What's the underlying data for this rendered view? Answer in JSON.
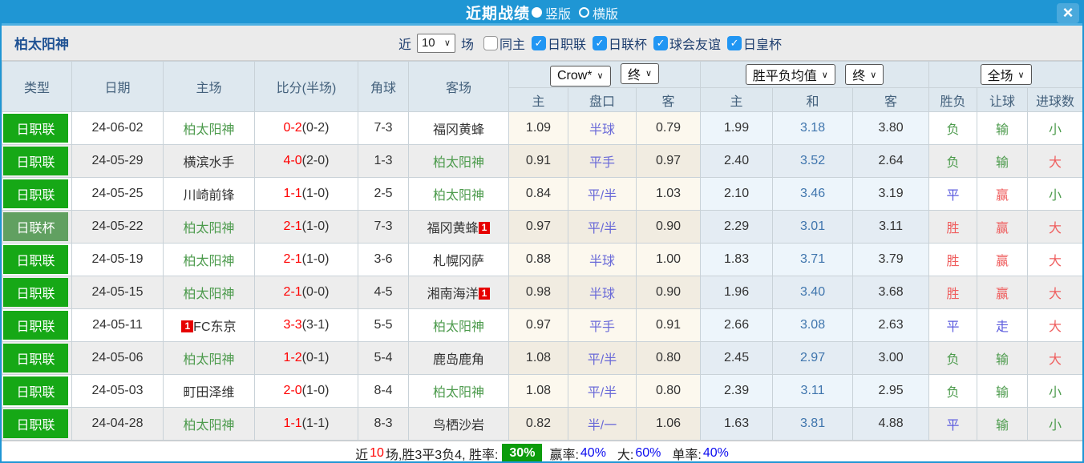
{
  "window": {
    "title": "近期战绩",
    "close_glyph": "×"
  },
  "layout_toggle": {
    "options": [
      {
        "label": "竖版",
        "selected": true
      },
      {
        "label": "横版",
        "selected": false
      }
    ]
  },
  "filter_bar": {
    "team_name": "柏太阳神",
    "recent_label": "近",
    "recent_count": "10",
    "games_label": "场",
    "checkboxes": [
      {
        "label": "同主",
        "checked": false
      },
      {
        "label": "日职联",
        "checked": true
      },
      {
        "label": "日联杯",
        "checked": true
      },
      {
        "label": "球会友谊",
        "checked": true
      },
      {
        "label": "日皇杯",
        "checked": true
      }
    ]
  },
  "table": {
    "dropdowns": {
      "odds_company": "Crow*",
      "odds_time1": "终",
      "avg_label": "胜平负均值",
      "odds_time2": "终",
      "period": "全场"
    },
    "columns": {
      "type": "类型",
      "date": "日期",
      "home": "主场",
      "score": "比分(半场)",
      "corner": "角球",
      "away": "客场",
      "sub": [
        "主",
        "盘口",
        "客",
        "主",
        "和",
        "客",
        "胜负",
        "让球",
        "进球数"
      ]
    },
    "rows": [
      {
        "league": "日职联",
        "league_type": "league",
        "date": "24-06-02",
        "home": "柏太阳神",
        "home_team": true,
        "home_red_before": "",
        "score": "0-2",
        "half": "(0-2)",
        "corner": "7-3",
        "away": "福冈黄蜂",
        "away_team": false,
        "away_red_after": "",
        "crow": [
          "1.09",
          "半球",
          "0.79"
        ],
        "avg": [
          "1.99",
          "3.18",
          "3.80"
        ],
        "results": [
          {
            "t": "负",
            "c": "green"
          },
          {
            "t": "输",
            "c": "green"
          },
          {
            "t": "小",
            "c": "green"
          }
        ]
      },
      {
        "league": "日职联",
        "league_type": "league",
        "date": "24-05-29",
        "home": "横滨水手",
        "home_team": false,
        "home_red_before": "",
        "score": "4-0",
        "half": "(2-0)",
        "corner": "1-3",
        "away": "柏太阳神",
        "away_team": true,
        "away_red_after": "",
        "crow": [
          "0.91",
          "平手",
          "0.97"
        ],
        "avg": [
          "2.40",
          "3.52",
          "2.64"
        ],
        "results": [
          {
            "t": "负",
            "c": "green"
          },
          {
            "t": "输",
            "c": "green"
          },
          {
            "t": "大",
            "c": "red"
          }
        ]
      },
      {
        "league": "日职联",
        "league_type": "league",
        "date": "24-05-25",
        "home": "川崎前锋",
        "home_team": false,
        "home_red_before": "",
        "score": "1-1",
        "half": "(1-0)",
        "corner": "2-5",
        "away": "柏太阳神",
        "away_team": true,
        "away_red_after": "",
        "crow": [
          "0.84",
          "平/半",
          "1.03"
        ],
        "avg": [
          "2.10",
          "3.46",
          "3.19"
        ],
        "results": [
          {
            "t": "平",
            "c": "blue"
          },
          {
            "t": "赢",
            "c": "red"
          },
          {
            "t": "小",
            "c": "green"
          }
        ]
      },
      {
        "league": "日联杯",
        "league_type": "cup",
        "date": "24-05-22",
        "home": "柏太阳神",
        "home_team": true,
        "home_red_before": "",
        "score": "2-1",
        "half": "(1-0)",
        "corner": "7-3",
        "away": "福冈黄蜂",
        "away_team": false,
        "away_red_after": "1",
        "crow": [
          "0.97",
          "平/半",
          "0.90"
        ],
        "avg": [
          "2.29",
          "3.01",
          "3.11"
        ],
        "results": [
          {
            "t": "胜",
            "c": "red"
          },
          {
            "t": "赢",
            "c": "red"
          },
          {
            "t": "大",
            "c": "red"
          }
        ]
      },
      {
        "league": "日职联",
        "league_type": "league",
        "date": "24-05-19",
        "home": "柏太阳神",
        "home_team": true,
        "home_red_before": "",
        "score": "2-1",
        "half": "(1-0)",
        "corner": "3-6",
        "away": "札幌冈萨",
        "away_team": false,
        "away_red_after": "",
        "crow": [
          "0.88",
          "半球",
          "1.00"
        ],
        "avg": [
          "1.83",
          "3.71",
          "3.79"
        ],
        "results": [
          {
            "t": "胜",
            "c": "red"
          },
          {
            "t": "赢",
            "c": "red"
          },
          {
            "t": "大",
            "c": "red"
          }
        ]
      },
      {
        "league": "日职联",
        "league_type": "league",
        "date": "24-05-15",
        "home": "柏太阳神",
        "home_team": true,
        "home_red_before": "",
        "score": "2-1",
        "half": "(0-0)",
        "corner": "4-5",
        "away": "湘南海洋",
        "away_team": false,
        "away_red_after": "1",
        "crow": [
          "0.98",
          "半球",
          "0.90"
        ],
        "avg": [
          "1.96",
          "3.40",
          "3.68"
        ],
        "results": [
          {
            "t": "胜",
            "c": "red"
          },
          {
            "t": "赢",
            "c": "red"
          },
          {
            "t": "大",
            "c": "red"
          }
        ]
      },
      {
        "league": "日职联",
        "league_type": "league",
        "date": "24-05-11",
        "home": "FC东京",
        "home_team": false,
        "home_red_before": "1",
        "score": "3-3",
        "half": "(3-1)",
        "corner": "5-5",
        "away": "柏太阳神",
        "away_team": true,
        "away_red_after": "",
        "crow": [
          "0.97",
          "平手",
          "0.91"
        ],
        "avg": [
          "2.66",
          "3.08",
          "2.63"
        ],
        "results": [
          {
            "t": "平",
            "c": "blue"
          },
          {
            "t": "走",
            "c": "blue"
          },
          {
            "t": "大",
            "c": "red"
          }
        ]
      },
      {
        "league": "日职联",
        "league_type": "league",
        "date": "24-05-06",
        "home": "柏太阳神",
        "home_team": true,
        "home_red_before": "",
        "score": "1-2",
        "half": "(0-1)",
        "corner": "5-4",
        "away": "鹿岛鹿角",
        "away_team": false,
        "away_red_after": "",
        "crow": [
          "1.08",
          "平/半",
          "0.80"
        ],
        "avg": [
          "2.45",
          "2.97",
          "3.00"
        ],
        "results": [
          {
            "t": "负",
            "c": "green"
          },
          {
            "t": "输",
            "c": "green"
          },
          {
            "t": "大",
            "c": "red"
          }
        ]
      },
      {
        "league": "日职联",
        "league_type": "league",
        "date": "24-05-03",
        "home": "町田泽维",
        "home_team": false,
        "home_red_before": "",
        "score": "2-0",
        "half": "(1-0)",
        "corner": "8-4",
        "away": "柏太阳神",
        "away_team": true,
        "away_red_after": "",
        "crow": [
          "1.08",
          "平/半",
          "0.80"
        ],
        "avg": [
          "2.39",
          "3.11",
          "2.95"
        ],
        "results": [
          {
            "t": "负",
            "c": "green"
          },
          {
            "t": "输",
            "c": "green"
          },
          {
            "t": "小",
            "c": "green"
          }
        ]
      },
      {
        "league": "日职联",
        "league_type": "league",
        "date": "24-04-28",
        "home": "柏太阳神",
        "home_team": true,
        "home_red_before": "",
        "score": "1-1",
        "half": "(1-1)",
        "corner": "8-3",
        "away": "鸟栖沙岩",
        "away_team": false,
        "away_red_after": "",
        "crow": [
          "0.82",
          "半/一",
          "1.06"
        ],
        "avg": [
          "1.63",
          "3.81",
          "4.88"
        ],
        "results": [
          {
            "t": "平",
            "c": "blue"
          },
          {
            "t": "输",
            "c": "green"
          },
          {
            "t": "小",
            "c": "green"
          }
        ]
      }
    ]
  },
  "summary": {
    "prefix": "近",
    "count": "10",
    "rest": "场,胜3平3负4, 胜率:",
    "rate": "30%",
    "win_label": "赢率:",
    "win_value": "40%",
    "big_label": "大:",
    "big_value": "60%",
    "single_label": "单率:",
    "single_value": "40%"
  },
  "colors": {
    "titlebar_blue": "#1f96d4",
    "checkbox_blue": "#2196f3",
    "league_badge_green": "#16a816",
    "cup_badge_green": "#61a061",
    "team_green": "#4d9b4d",
    "score_red": "#ff0000",
    "handicap_purple": "#6a6ad8",
    "result_red": "#ef5d5d",
    "result_blue": "#5b5bde",
    "summary_badge_green": "#0c9c0c",
    "summary_pct_blue": "#0b0bf0"
  }
}
